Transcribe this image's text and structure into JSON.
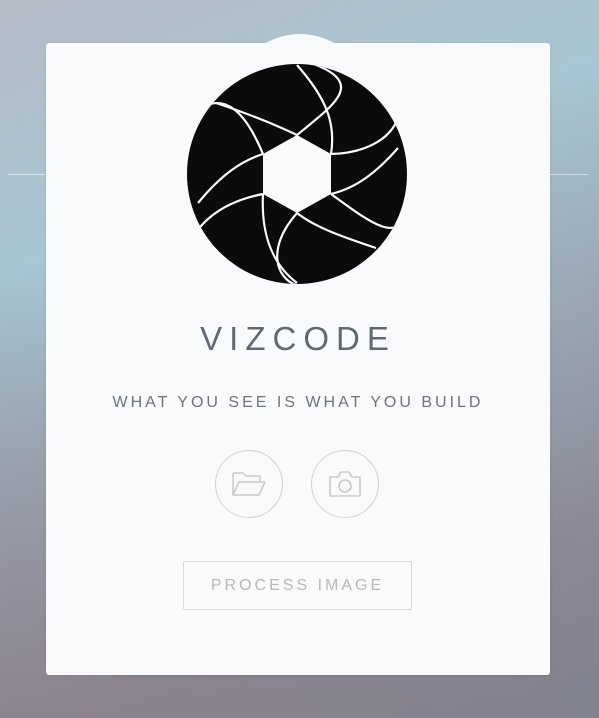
{
  "app": {
    "name": "VIZCODE",
    "tagline": "WHAT YOU SEE IS WHAT YOU BUILD"
  },
  "icons": {
    "logo": "camera-aperture-icon",
    "open": "folder-open-icon",
    "camera": "camera-icon"
  },
  "actions": {
    "process_label": "PROCESS IMAGE"
  },
  "colors": {
    "logo": "#0b0b0c",
    "text": "#616a74",
    "muted": "#b5babe",
    "card": "#f9fafb"
  }
}
